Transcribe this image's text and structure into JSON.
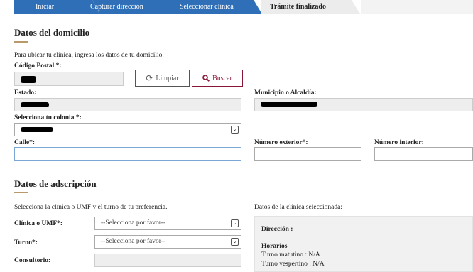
{
  "stepper": {
    "steps": [
      {
        "label": "Iniciar"
      },
      {
        "label": "Capturar dirección"
      },
      {
        "label": "Seleccionar clínica"
      },
      {
        "label": "Trámite finalizado"
      }
    ],
    "active_color": "#2f6fb7"
  },
  "domicilio": {
    "title": "Datos del domicilio",
    "instruction": "Para ubicar tu clínica, ingresa los datos de tu domicilio.",
    "codigo_postal_label": "Código Postal *:",
    "clear_label": "Limpiar",
    "search_label": "Buscar",
    "estado_label": "Estado:",
    "municipio_label": "Municipio o Alcaldía:",
    "colonia_label": "Selecciona tu colonia *:",
    "calle_label": "Calle*:",
    "num_ext_label": "Número exterior*:",
    "num_int_label": "Número interior:"
  },
  "adscripcion": {
    "title": "Datos de adscripción",
    "instruction": "Selecciona la clínica o UMF y el turno de tu preferencia.",
    "clinic_info_heading": "Datos de la clínica seleccionada:",
    "clinica_label": "Clínica o UMF*:",
    "clinica_value": "--Selecciona por favor--",
    "turno_label": "Turno*:",
    "turno_value": "--Selecciona por favor--",
    "consultorio_label": "Consultorio:"
  },
  "clinic_panel": {
    "direccion_label": "Dirección :",
    "horarios_label": "Horarios",
    "turno_matutino": "Turno matutino : N/A",
    "turno_vespertino": "Turno vespertino : N/A"
  },
  "colors": {
    "accent": "#8a1538",
    "rule": "#b89a6a"
  }
}
